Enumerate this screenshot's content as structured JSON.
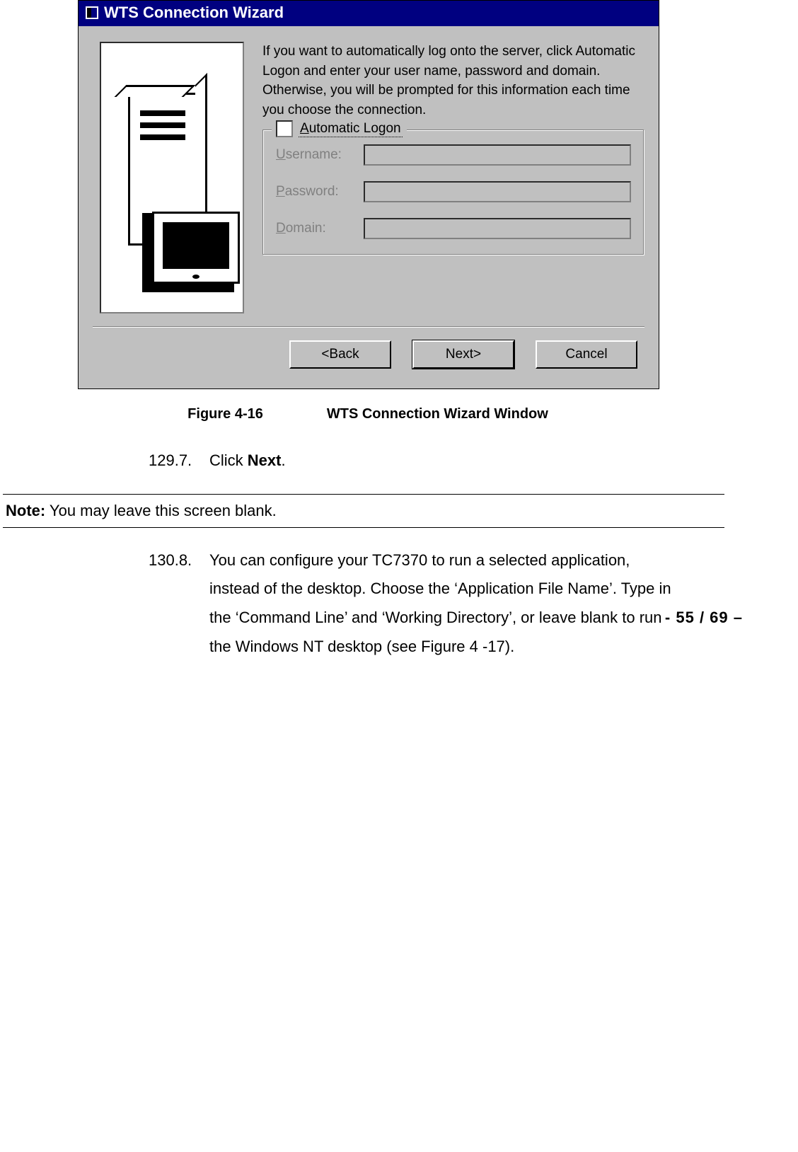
{
  "dialog": {
    "title": "WTS Connection Wizard",
    "instructions": "If you want to automatically log onto the server, click Automatic Logon and enter your user name, password and domain. Otherwise, you will be prompted for this information each time you choose the connection.",
    "checkbox_label": "Automatic Logon",
    "fields": {
      "username": {
        "label": "Username:",
        "value": ""
      },
      "password": {
        "label": "Password:",
        "value": ""
      },
      "domain": {
        "label": "Domain:",
        "value": ""
      }
    },
    "buttons": {
      "back": "<Back",
      "next": "Next>",
      "cancel": "Cancel"
    }
  },
  "caption": {
    "fig": "Figure 4-16",
    "title": "WTS Connection Wizard Window"
  },
  "step1": {
    "num": "129.7.",
    "prefix": "Click ",
    "bold": "Next",
    "suffix": "."
  },
  "note": {
    "label": "Note:",
    "text": " You may leave this screen blank."
  },
  "step2": {
    "num": "130.8.",
    "text": "You can configure your TC7370 to run a selected application, instead of the desktop.  Choose the ‘Application File Name’.  Type in the ‘Command Line’ and ‘Working Directory’, or leave blank to run the Windows NT desktop (see Figure 4 -17)."
  },
  "page_number": "- 55 / 69 –"
}
